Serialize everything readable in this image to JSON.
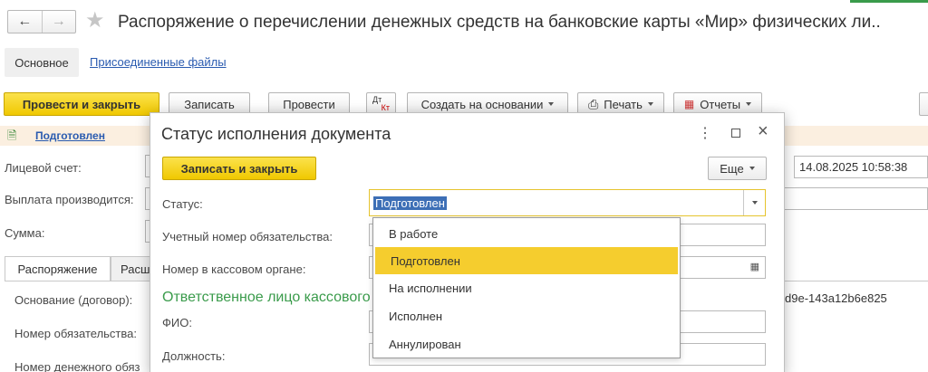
{
  "window": {
    "title": "Распоряжение о перечислении денежных средств на банковские карты «Мир» физических ли..",
    "tabs": [
      "Основное",
      "Присоединенные файлы"
    ]
  },
  "toolbar": {
    "post_close": "Провести и закрыть",
    "save": "Записать",
    "post": "Провести",
    "dt_kt_top": "Дт",
    "dt_kt_bottom": "Кт",
    "create_based": "Создать на основании",
    "print": "Печать",
    "reports": "Отчеты"
  },
  "status_bar": {
    "link": "Подготовлен"
  },
  "form": {
    "account_label": "Лицевой счет:",
    "payout_label": "Выплата производится:",
    "amount_label": "Сумма:",
    "tab_order": "Распоряжение",
    "tab_other": "Расш",
    "basis_label": "Основание (договор):",
    "obligation_label": "Номер обязательства:",
    "money_no_label": "Номер денежного обяз",
    "date_value": "14.08.2025 10:58:38",
    "guid_fragment": "d9e-143a12b6e825"
  },
  "dialog": {
    "title": "Статус исполнения документа",
    "save_close": "Записать и закрыть",
    "more": "Еще",
    "status_label": "Статус:",
    "status_value": "Подготовлен",
    "reg_label": "Учетный номер обязательства:",
    "cash_label": "Номер в кассовом органе:",
    "section": "Ответственное лицо кассового",
    "fio_label": "ФИО:",
    "position_label": "Должность:",
    "options": [
      "В работе",
      "Подготовлен",
      "На исполнении",
      "Исполнен",
      "Аннулирован"
    ],
    "selected_index": 1
  }
}
